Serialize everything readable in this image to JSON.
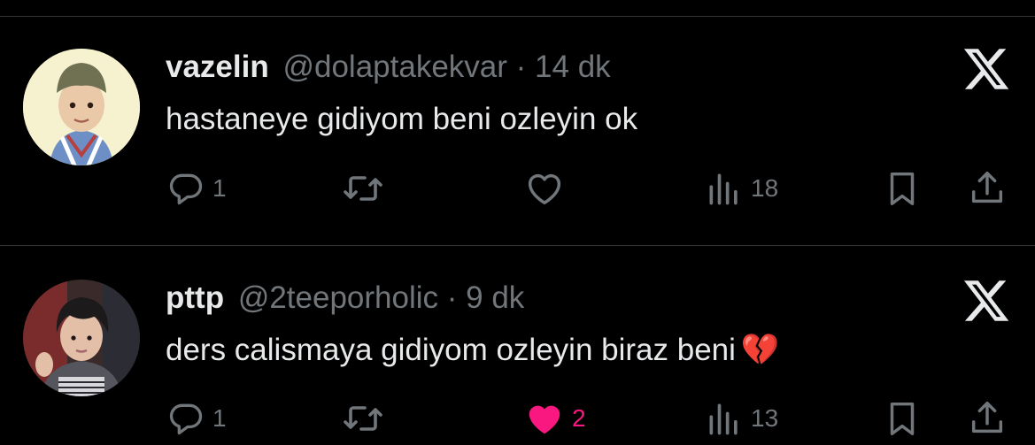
{
  "tweets": [
    {
      "name": "vazelin",
      "handle": "@dolaptakekvar",
      "dot": "·",
      "time": "14 dk",
      "text": "hastaneye gidiyom beni ozleyin ok",
      "emoji": "",
      "replies": "1",
      "retweets": "",
      "likes": "",
      "liked": false,
      "views": "18",
      "avatar_icon": "avatar-child-hat"
    },
    {
      "name": "pttp",
      "handle": "@2teeporholic",
      "dot": "·",
      "time": "9 dk",
      "text": "ders calismaya gidiyom ozleyin biraz beni",
      "emoji": "💔",
      "replies": "1",
      "retweets": "",
      "likes": "2",
      "liked": true,
      "views": "13",
      "avatar_icon": "avatar-young-man"
    }
  ],
  "colors": {
    "background": "#000000",
    "text": "#e7e9ea",
    "muted": "#71767b",
    "divider": "#2f3336",
    "like": "#f91880"
  }
}
